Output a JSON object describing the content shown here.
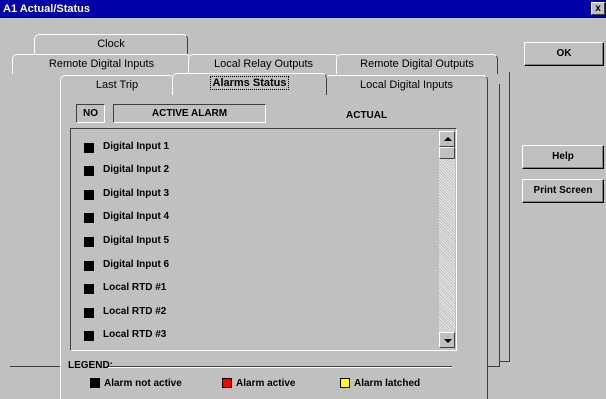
{
  "window": {
    "title": "A1 Actual/Status",
    "close_glyph": "x"
  },
  "tabs": {
    "row1": [
      "Clock"
    ],
    "row2": [
      "Remote Digital Inputs",
      "Local Relay Outputs",
      "Remote Digital Outputs"
    ],
    "row3": [
      "Last Trip",
      "Alarms Status",
      "Local Digital Inputs"
    ],
    "active": "Alarms Status"
  },
  "headers": {
    "no": "NO",
    "active_alarm": "ACTIVE ALARM",
    "actual": "ACTUAL"
  },
  "alarms": [
    "Digital Input 1",
    "Digital Input 2",
    "Digital Input 3",
    "Digital Input 4",
    "Digital Input 5",
    "Digital Input 6",
    "Local RTD #1",
    "Local RTD #2",
    "Local RTD #3"
  ],
  "legend": {
    "title": "LEGEND:",
    "items": [
      {
        "label": "Alarm not active",
        "color": "#000000"
      },
      {
        "label": "Alarm active",
        "color": "#ff0000"
      },
      {
        "label": "Alarm latched",
        "color": "#ffff00"
      }
    ]
  },
  "buttons": {
    "ok": "OK",
    "help": "Help",
    "print_screen": "Print Screen"
  }
}
